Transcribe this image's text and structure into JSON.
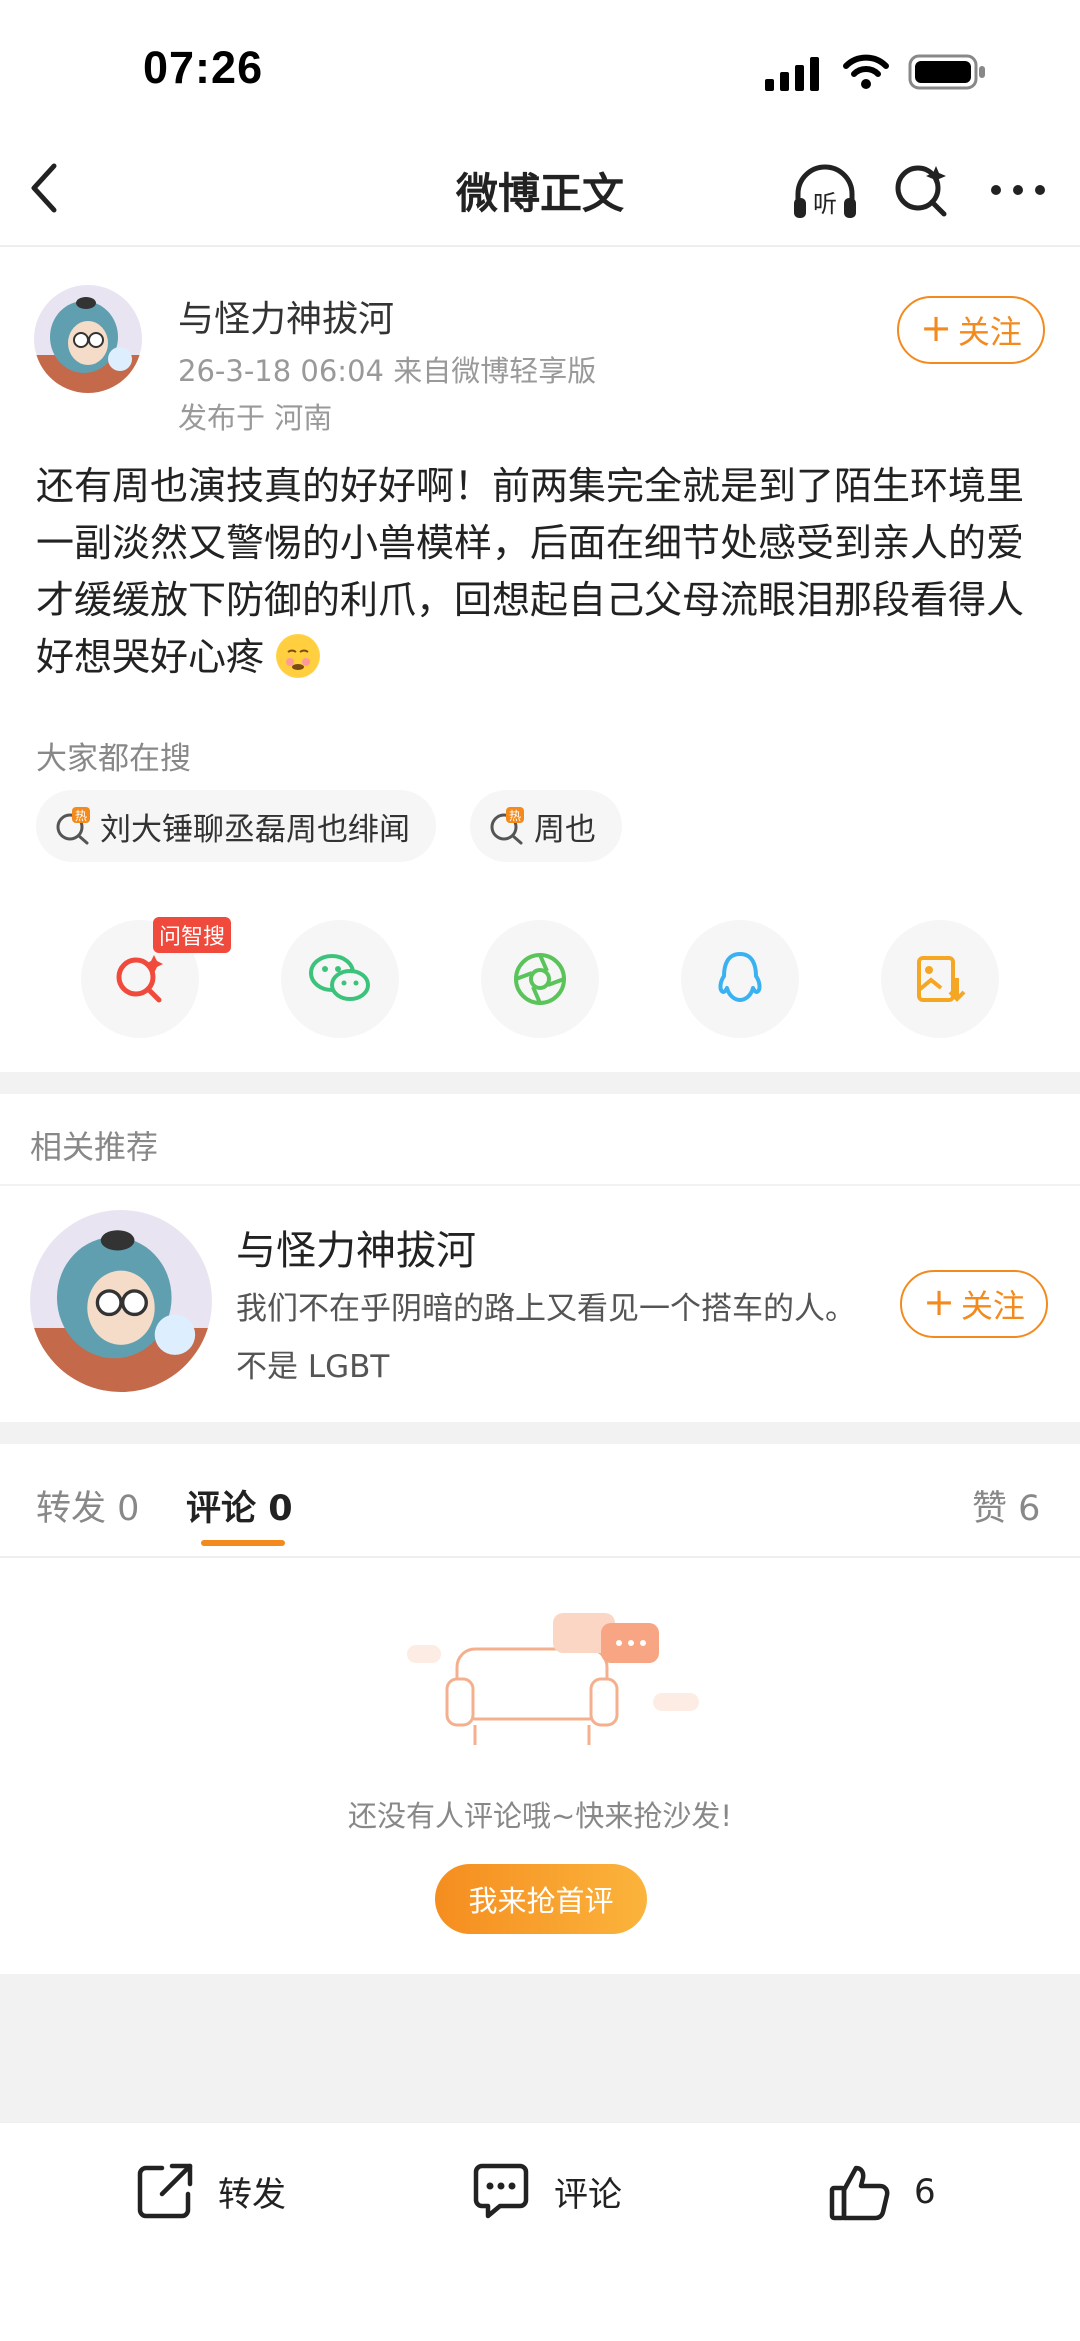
{
  "status_bar": {
    "time": "07:26"
  },
  "nav": {
    "title": "微博正文"
  },
  "post": {
    "author": "与怪力神拔河",
    "meta": "26-3-18 06:04  来自微博轻享版",
    "location": "发布于 河南",
    "follow_label": "关注",
    "body": "还有周也演技真的好好啊！前两集完全就是到了陌生环境里一副淡然又警惕的小兽模样，后面在细节处感受到亲人的爱才缓缓放下防御的利爪，回想起自己父母流眼泪那段看得人好想哭好心疼"
  },
  "hot_search": {
    "label": "大家都在搜",
    "chips": [
      "刘大锤聊丞磊周也绯闻",
      "周也"
    ]
  },
  "share": {
    "badge": "问智搜"
  },
  "recommend": {
    "label": "相关推荐",
    "name": "与怪力神拔河",
    "desc": "我们不在乎阴暗的路上又看见一个搭车的人。不是 LGBT",
    "follow_label": "关注"
  },
  "tabs": {
    "repost": "转发",
    "repost_count": "0",
    "comment": "评论",
    "comment_count": "0",
    "like": "赞",
    "like_count": "6"
  },
  "empty": {
    "text": "还没有人评论哦~快来抢沙发!",
    "button": "我来抢首评"
  },
  "bottom_bar": {
    "repost": "转发",
    "comment": "评论",
    "like_count": "6"
  },
  "colors": {
    "accent": "#f38a1d",
    "badge": "#f04a3c",
    "wechat": "#3cc37b",
    "qq": "#3ab1f0",
    "moments": "#5ac35a",
    "save": "#f5a623"
  }
}
